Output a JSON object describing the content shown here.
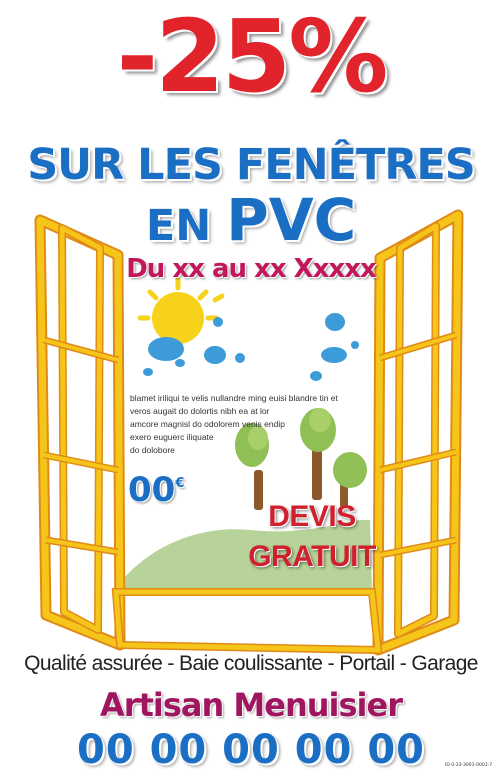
{
  "headline": {
    "discount": "-25%",
    "line1": "SUR LES FENÊTRES",
    "line2_prefix": "EN",
    "line2_big": "PVC",
    "dates": "Du xx au xx  Xxxxx"
  },
  "body_text": [
    "blamet iriliqui te velis nullandre ming euisi blandre tin et",
    "veros augait do dolortis nibh ea at lor",
    "amcore magnisl do odolorem venis endip",
    "exero euguerc iliquate",
    "do dolobore"
  ],
  "price": {
    "value": "00",
    "currency": "€"
  },
  "badge": {
    "line1": "DEVIS",
    "line2": "GRATUIT"
  },
  "services": "Qualité assurée - Baie coulissante - Portail - Garage",
  "artisan": "Artisan Menuisier",
  "phone": "00 00 00 00 00",
  "reference": "ID 0-33-3001-0001-7",
  "colors": {
    "red": "#e1232b",
    "blue": "#1a6fc4",
    "magenta": "#c2185b",
    "frame_yellow": "#f6c51a",
    "frame_orange": "#e08a17"
  }
}
